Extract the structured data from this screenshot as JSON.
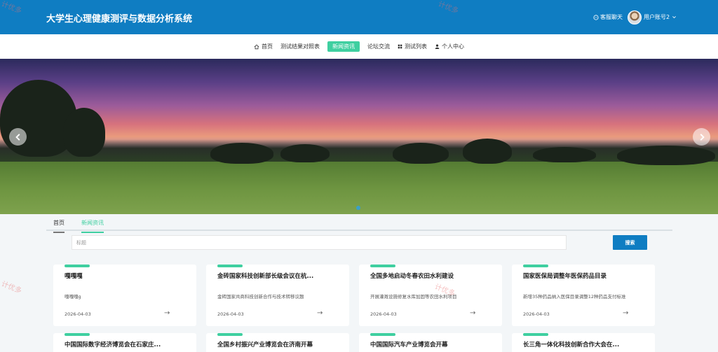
{
  "header": {
    "site_title": "大学生心理健康测评与数据分析系统",
    "chat_label": "客服聊天",
    "user_label": "用户账号2"
  },
  "nav": {
    "items": [
      {
        "label": "首页",
        "icon": "home-icon"
      },
      {
        "label": "测试结果对照表",
        "icon": ""
      },
      {
        "label": "新闻资讯",
        "icon": "",
        "active": true
      },
      {
        "label": "论坛交流",
        "icon": ""
      },
      {
        "label": "测试列表",
        "icon": "grid-icon"
      },
      {
        "label": "个人中心",
        "icon": "person-icon"
      }
    ]
  },
  "banner": {
    "slide_count_dot": ""
  },
  "tabs": {
    "home": "首页",
    "news": "新闻资讯"
  },
  "search": {
    "placeholder": "标题",
    "button": "搜索"
  },
  "cards": [
    {
      "title": "嘎嘎嘎",
      "desc": "嘎嘎嘎g",
      "date": "2026-04-03",
      "arrow": "→"
    },
    {
      "title": "金砖国家科技创新部长级会议在杭...",
      "desc": "金砖国家共商科技创新合作与技术转移议题",
      "date": "2026-04-03",
      "arrow": "→"
    },
    {
      "title": "全国多地启动冬春农田水利建设",
      "desc": "开展灌溉设施修复水库加固等农田水利项目",
      "date": "2026-04-03",
      "arrow": "→"
    },
    {
      "title": "国家医保局调整年医保药品目录",
      "desc": "新增35种药品纳入医保目录调整12种药品支付标准",
      "date": "2026-04-03",
      "arrow": "→"
    },
    {
      "title": "中国国际数字经济博览会在石家庄...",
      "desc": "",
      "date": "",
      "arrow": ""
    },
    {
      "title": "全国乡村振兴产业博览会在济南开幕",
      "desc": "",
      "date": "",
      "arrow": ""
    },
    {
      "title": "中国国际汽车产业博览会开幕",
      "desc": "",
      "date": "",
      "arrow": ""
    },
    {
      "title": "长三角一体化科技创新合作大会在...",
      "desc": "",
      "date": "",
      "arrow": ""
    }
  ],
  "watermark": "计优多",
  "colors": {
    "primary": "#0f7dc2",
    "accent": "#3fcfa0"
  }
}
